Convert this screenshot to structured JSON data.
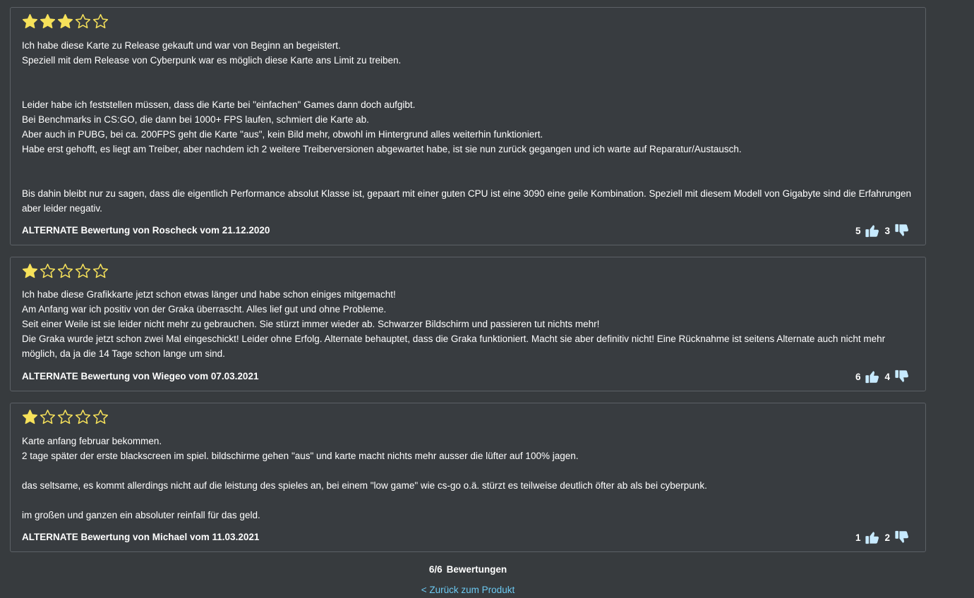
{
  "colors": {
    "background": "#373b3e",
    "star": "#f6e15a",
    "thumb": "#c7eaff",
    "link": "#6cc9f2"
  },
  "reviews": [
    {
      "rating": 3,
      "max_rating": 5,
      "paragraphs": [
        "Ich habe diese Karte zu Release gekauft und war von Beginn an begeistert.",
        "Speziell mit dem Release von Cyberpunk war es möglich diese Karte ans Limit zu treiben.",
        "",
        "",
        "Leider habe ich feststellen müssen, dass die Karte bei \"einfachen\" Games dann doch aufgibt.",
        "Bei Benchmarks in CS:GO, die dann bei 1000+ FPS laufen, schmiert die Karte ab.",
        "Aber auch in PUBG, bei ca. 200FPS geht die Karte \"aus\", kein Bild mehr, obwohl im Hintergrund alles weiterhin funktioniert.",
        "Habe erst gehofft, es liegt am Treiber, aber nachdem ich 2 weitere Treiberversionen abgewartet habe, ist sie nun zurück gegangen und ich warte auf Reparatur/Austausch.",
        "",
        "",
        "Bis dahin bleibt nur zu sagen, dass die eigentlich Performance absolut Klasse ist, gepaart mit einer guten CPU ist eine 3090 eine geile Kombination. Speziell mit diesem Modell von Gigabyte sind die Erfahrungen aber leider negativ."
      ],
      "author_line": "ALTERNATE Bewertung von Roscheck vom 21.12.2020",
      "likes": "5",
      "dislikes": "3"
    },
    {
      "rating": 1,
      "max_rating": 5,
      "paragraphs": [
        "Ich habe diese Grafikkarte jetzt schon etwas länger und habe schon einiges mitgemacht!",
        "Am Anfang war ich positiv von der Graka überrascht. Alles lief gut und ohne Probleme.",
        "Seit einer Weile ist sie leider nicht mehr zu gebrauchen. Sie stürzt immer wieder ab. Schwarzer Bildschirm und passieren tut nichts mehr!",
        "Die Graka wurde jetzt schon zwei Mal eingeschickt! Leider ohne Erfolg. Alternate behauptet, dass die Graka funktioniert. Macht sie aber definitiv nicht! Eine Rücknahme ist seitens Alternate auch nicht mehr möglich, da ja die 14 Tage schon lange um sind."
      ],
      "author_line": "ALTERNATE Bewertung von Wiegeo vom 07.03.2021",
      "likes": "6",
      "dislikes": "4"
    },
    {
      "rating": 1,
      "max_rating": 5,
      "paragraphs": [
        "Karte anfang februar bekommen.",
        "2 tage später der erste blackscreen im spiel. bildschirme gehen \"aus\" und karte macht nichts mehr ausser die lüfter auf 100% jagen.",
        "",
        "das seltsame, es kommt allerdings nicht auf die leistung des spieles an, bei einem \"low game\" wie cs-go o.ä. stürzt es teilweise deutlich öfter ab als bei cyberpunk.",
        "",
        "im großen und ganzen ein absoluter reinfall für das geld."
      ],
      "author_line": "ALTERNATE Bewertung von Michael vom 11.03.2021",
      "likes": "1",
      "dislikes": "2"
    }
  ],
  "footer": {
    "count": "6/6",
    "count_label": "Bewertungen",
    "back_link": "< Zurück zum Produkt"
  }
}
